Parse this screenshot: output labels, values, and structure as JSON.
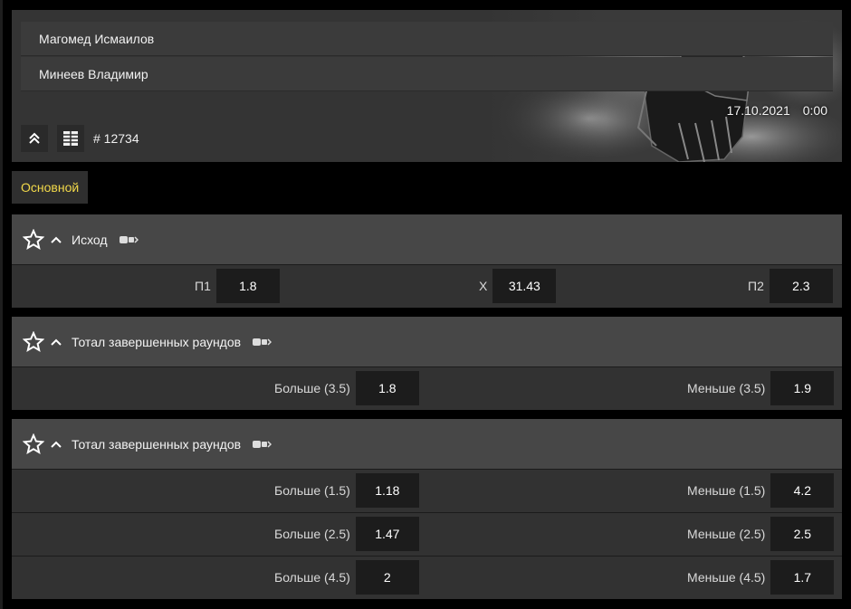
{
  "event": {
    "team1": "Магомед Исмаилов",
    "team2": "Минеев Владимир",
    "date": "17.10.2021",
    "time": "0:00",
    "id": "# 12734"
  },
  "tabs": [
    {
      "label": "Основной",
      "active": true
    }
  ],
  "colors": {
    "tab_active": "#f2d94a",
    "market_head": "#474747",
    "odd_box": "#1c1c1c"
  },
  "markets": [
    {
      "title": "Исход",
      "rows": [
        [
          {
            "label": "П1",
            "odd": "1.8"
          },
          {
            "label": "Х",
            "odd": "31.43"
          },
          {
            "label": "П2",
            "odd": "2.3"
          }
        ]
      ]
    },
    {
      "title": "Тотал завершенных раундов",
      "rows": [
        [
          {
            "label": "Больше (3.5)",
            "odd": "1.8"
          },
          {
            "label": "Меньше (3.5)",
            "odd": "1.9"
          }
        ]
      ]
    },
    {
      "title": "Тотал завершенных раундов",
      "rows": [
        [
          {
            "label": "Больше (1.5)",
            "odd": "1.18"
          },
          {
            "label": "Меньше (1.5)",
            "odd": "4.2"
          }
        ],
        [
          {
            "label": "Больше (2.5)",
            "odd": "1.47"
          },
          {
            "label": "Меньше (2.5)",
            "odd": "2.5"
          }
        ],
        [
          {
            "label": "Больше (4.5)",
            "odd": "2"
          },
          {
            "label": "Меньше (4.5)",
            "odd": "1.7"
          }
        ]
      ]
    }
  ]
}
